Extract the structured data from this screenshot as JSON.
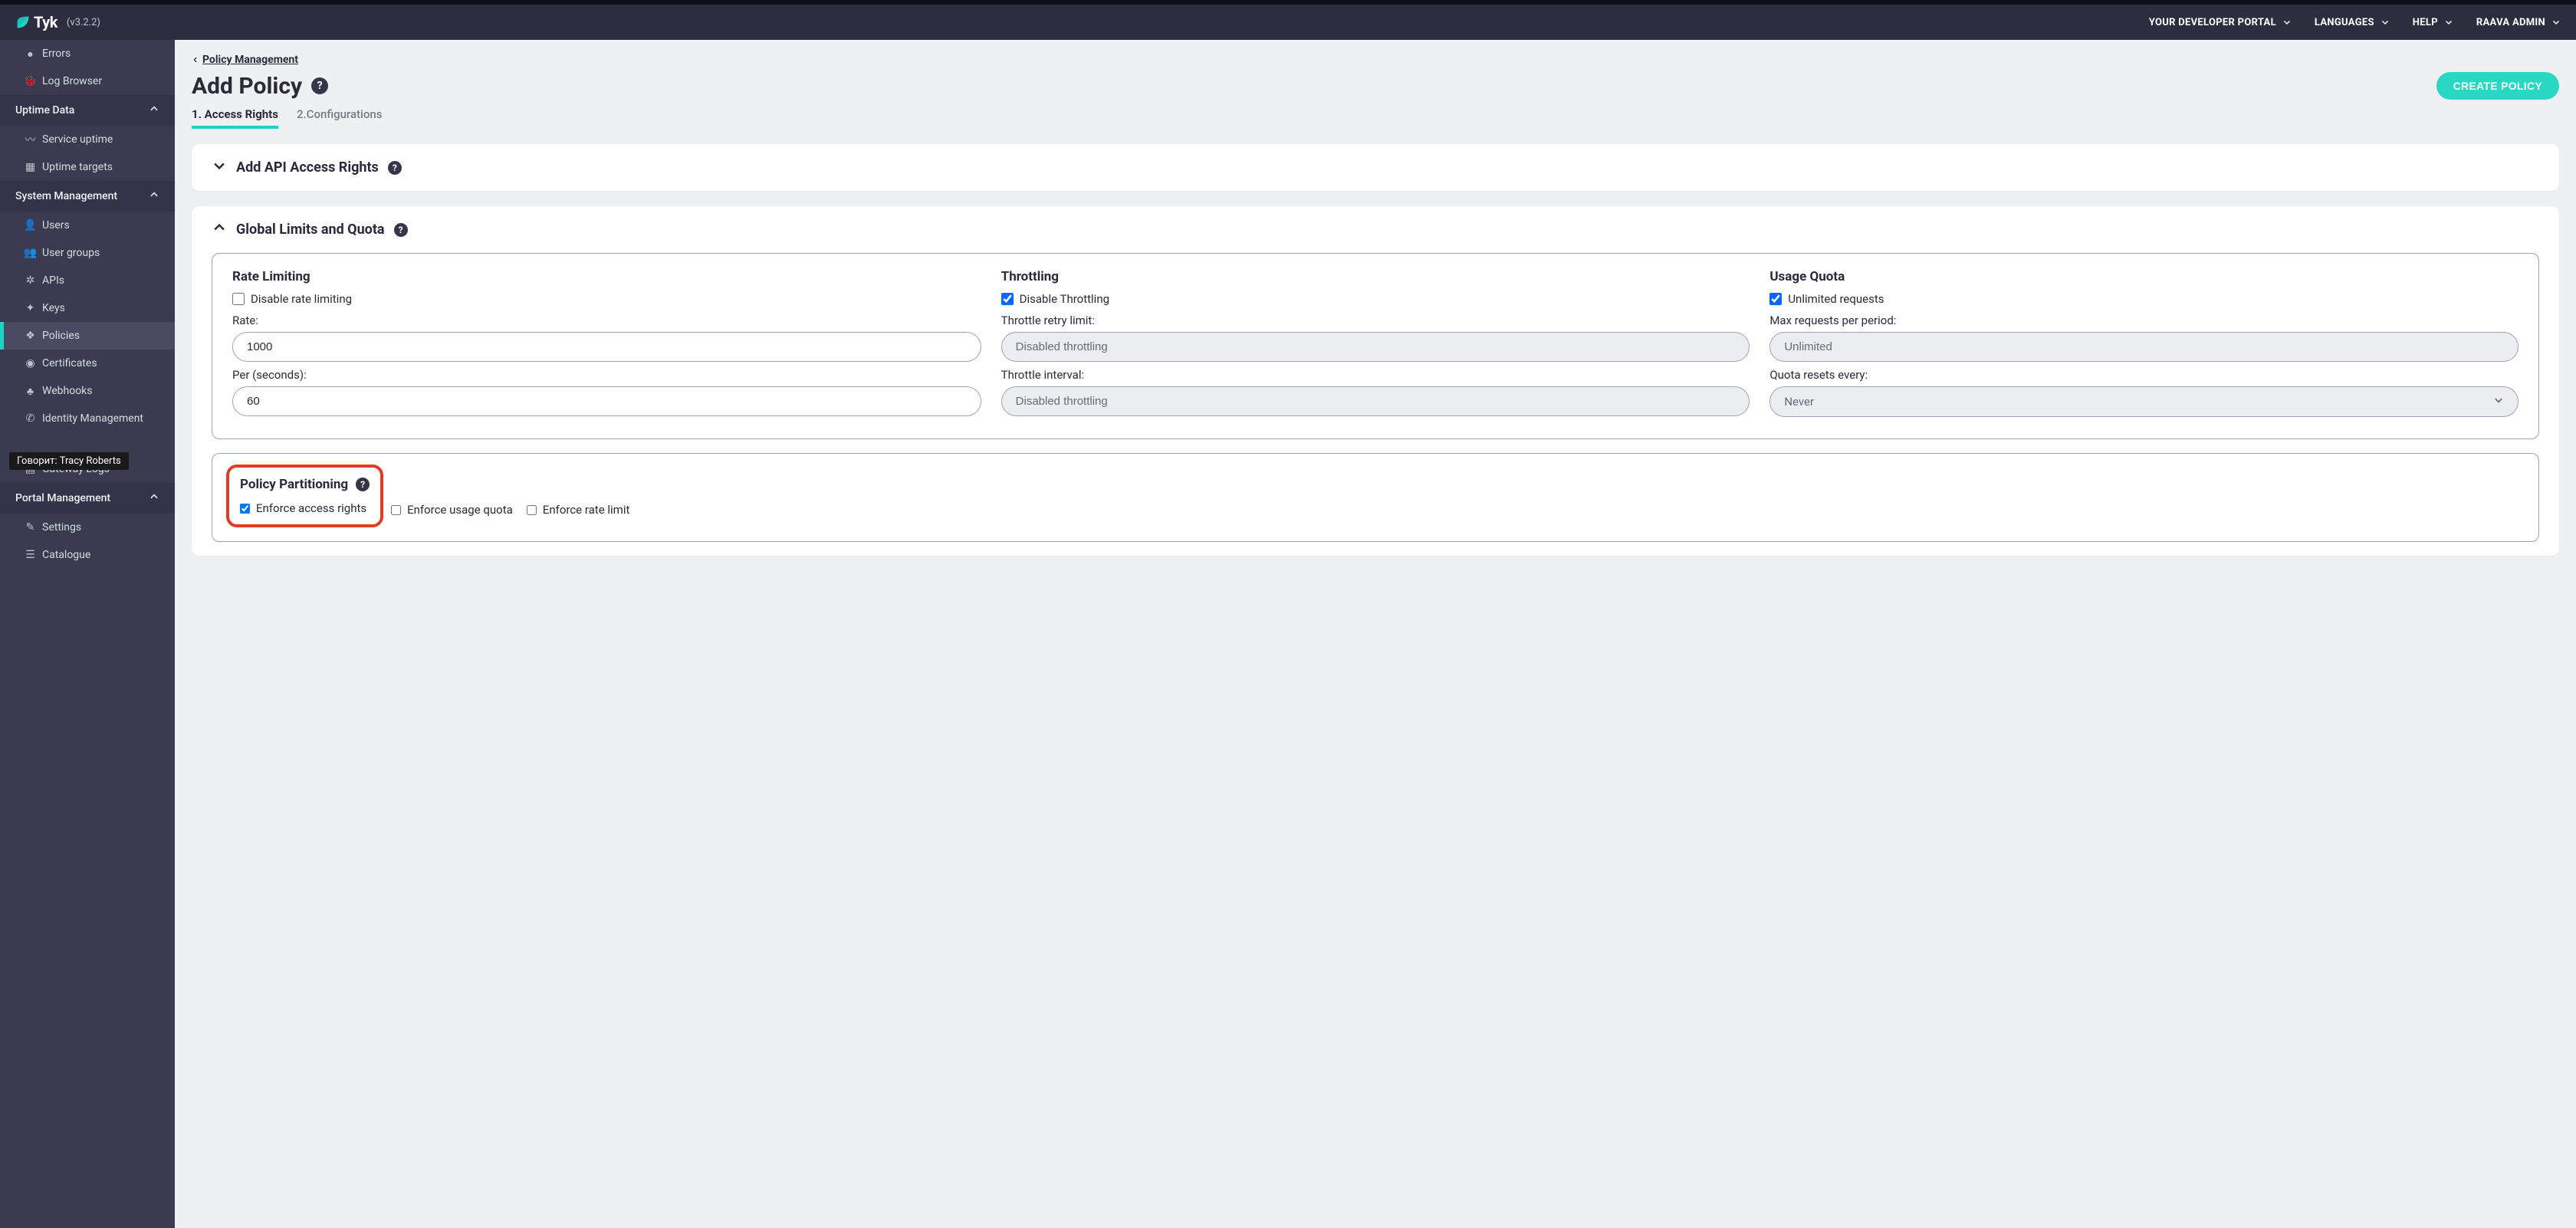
{
  "app": {
    "name": "Tyk",
    "version": "(v3.2.2)"
  },
  "topnav": {
    "portal": "YOUR DEVELOPER PORTAL",
    "languages": "LANGUAGES",
    "help": "HELP",
    "user": "RAAVA ADMIN"
  },
  "sidebar": {
    "items_top": [
      {
        "label": "Errors",
        "icon": "bullet"
      },
      {
        "label": "Log Browser",
        "icon": "bug"
      }
    ],
    "section_uptime": "Uptime Data",
    "uptime_items": [
      {
        "label": "Service uptime",
        "icon": "dash"
      },
      {
        "label": "Uptime targets",
        "icon": "grid"
      }
    ],
    "section_system": "System Management",
    "system_items": [
      {
        "label": "Users",
        "icon": "user"
      },
      {
        "label": "User groups",
        "icon": "users"
      },
      {
        "label": "APIs",
        "icon": "gear"
      },
      {
        "label": "Keys",
        "icon": "key"
      },
      {
        "label": "Policies",
        "icon": "shield",
        "active": true
      },
      {
        "label": "Certificates",
        "icon": "dot"
      },
      {
        "label": "Webhooks",
        "icon": "hook"
      },
      {
        "label": "Identity Management",
        "icon": "id"
      }
    ],
    "gateway_logs": "Gateway Logs",
    "section_portal": "Portal Management",
    "portal_items": [
      {
        "label": "Settings",
        "icon": "wrench"
      },
      {
        "label": "Catalogue",
        "icon": "list"
      }
    ]
  },
  "caption": "Говорит: Tracy Roberts",
  "breadcrumb": "Policy Management",
  "page_title": "Add Policy",
  "create_button": "CREATE POLICY",
  "tabs": {
    "t1": "1. Access Rights",
    "t2": "2.Configurations"
  },
  "section_api_rights": "Add API Access Rights",
  "section_global": "Global Limits and Quota",
  "rate": {
    "title": "Rate Limiting",
    "disable_label": "Disable rate limiting",
    "rate_label": "Rate:",
    "rate_value": "1000",
    "per_label": "Per (seconds):",
    "per_value": "60"
  },
  "throttle": {
    "title": "Throttling",
    "disable_label": "Disable Throttling",
    "retry_label": "Throttle retry limit:",
    "retry_value": "Disabled throttling",
    "interval_label": "Throttle interval:",
    "interval_value": "Disabled throttling"
  },
  "quota": {
    "title": "Usage Quota",
    "unlimited_label": "Unlimited requests",
    "max_label": "Max requests per period:",
    "max_value": "Unlimited",
    "reset_label": "Quota resets every:",
    "reset_value": "Never"
  },
  "partition": {
    "title": "Policy Partitioning",
    "enforce_access": "Enforce access rights",
    "enforce_quota": "Enforce usage quota",
    "enforce_rate": "Enforce rate limit"
  }
}
